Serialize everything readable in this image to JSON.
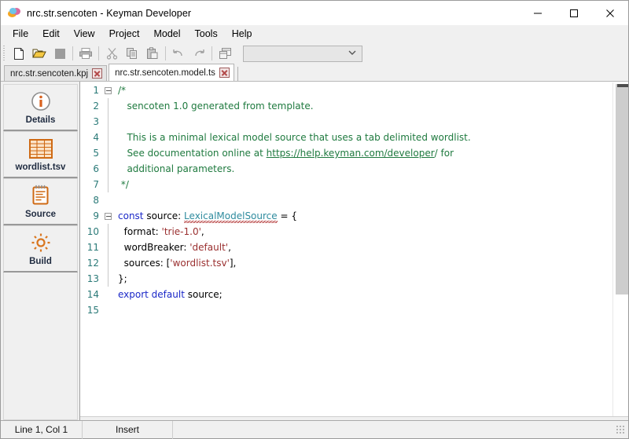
{
  "window": {
    "title": "nrc.str.sencoten - Keyman Developer",
    "icon": "keyman-logo-icon",
    "controls": [
      {
        "name": "minimize-button",
        "glyph": "minimize"
      },
      {
        "name": "maximize-button",
        "glyph": "maximize"
      },
      {
        "name": "close-button",
        "glyph": "close"
      }
    ]
  },
  "menubar": {
    "items": [
      {
        "label": "File"
      },
      {
        "label": "Edit"
      },
      {
        "label": "View"
      },
      {
        "label": "Project"
      },
      {
        "label": "Model"
      },
      {
        "label": "Tools"
      },
      {
        "label": "Help"
      }
    ]
  },
  "toolbar": {
    "buttons": [
      {
        "name": "new-file-button",
        "icon": "new-document-icon"
      },
      {
        "name": "open-file-button",
        "icon": "open-folder-icon"
      },
      {
        "name": "save-file-button",
        "icon": "save-disk-icon"
      },
      {
        "name": "print-button",
        "icon": "printer-icon"
      },
      {
        "name": "cut-button",
        "icon": "scissors-icon"
      },
      {
        "name": "copy-button",
        "icon": "copy-icon"
      },
      {
        "name": "paste-button",
        "icon": "paste-icon"
      },
      {
        "name": "undo-button",
        "icon": "undo-arrow-icon"
      },
      {
        "name": "redo-button",
        "icon": "redo-arrow-icon"
      },
      {
        "name": "windows-button",
        "icon": "cascade-windows-icon"
      }
    ],
    "combo": {
      "value": "",
      "placeholder": ""
    }
  },
  "tabs": [
    {
      "label": "nrc.str.sencoten.kpj",
      "active": false,
      "close": "close-tab-icon"
    },
    {
      "label": "nrc.str.sencoten.model.ts",
      "active": true,
      "close": "close-tab-icon"
    }
  ],
  "sidebar": {
    "items": [
      {
        "label": "Details",
        "icon": "info-circle-icon"
      },
      {
        "label": "wordlist.tsv",
        "icon": "table-grid-icon"
      },
      {
        "label": "Source",
        "icon": "notepad-icon"
      },
      {
        "label": "Build",
        "icon": "gear-icon"
      }
    ]
  },
  "editor": {
    "lines": [
      {
        "num": "1",
        "fold": "collapse",
        "segments": [
          {
            "t": "/*",
            "c": "c-com"
          }
        ]
      },
      {
        "num": "2",
        "fold": "bar",
        "segments": [
          {
            "t": "   sencoten 1.0 generated from template.",
            "c": "c-com"
          }
        ]
      },
      {
        "num": "3",
        "fold": "bar",
        "segments": []
      },
      {
        "num": "4",
        "fold": "bar",
        "segments": [
          {
            "t": "   This is a minimal lexical model source that uses a tab delimited wordlist.",
            "c": "c-com"
          }
        ]
      },
      {
        "num": "5",
        "fold": "bar",
        "segments": [
          {
            "t": "   See documentation online at ",
            "c": "c-com"
          },
          {
            "t": "https://help.keyman.com/developer",
            "c": "link"
          },
          {
            "t": "/ for",
            "c": "c-com"
          }
        ]
      },
      {
        "num": "6",
        "fold": "bar",
        "segments": [
          {
            "t": "   additional parameters.",
            "c": "c-com"
          }
        ]
      },
      {
        "num": "7",
        "fold": "bar",
        "segments": [
          {
            "t": " */",
            "c": "c-com"
          }
        ]
      },
      {
        "num": "8",
        "fold": "none",
        "segments": []
      },
      {
        "num": "9",
        "fold": "collapse",
        "segments": [
          {
            "t": "const",
            "c": "c-kw"
          },
          {
            "t": " source: ",
            "c": "c-id"
          },
          {
            "t": "LexicalModelSource",
            "c": "c-type squig"
          },
          {
            "t": " = {",
            "c": "c-id"
          }
        ]
      },
      {
        "num": "10",
        "fold": "bar",
        "segments": [
          {
            "t": "  format: ",
            "c": "c-id"
          },
          {
            "t": "'trie-1.0'",
            "c": "c-str"
          },
          {
            "t": ",",
            "c": "c-id"
          }
        ]
      },
      {
        "num": "11",
        "fold": "bar",
        "segments": [
          {
            "t": "  wordBreaker: ",
            "c": "c-id"
          },
          {
            "t": "'default'",
            "c": "c-str"
          },
          {
            "t": ",",
            "c": "c-id"
          }
        ]
      },
      {
        "num": "12",
        "fold": "bar",
        "segments": [
          {
            "t": "  sources: [",
            "c": "c-id"
          },
          {
            "t": "'wordlist.tsv'",
            "c": "c-str"
          },
          {
            "t": "],",
            "c": "c-id"
          }
        ]
      },
      {
        "num": "13",
        "fold": "bar",
        "segments": [
          {
            "t": "};",
            "c": "c-id"
          }
        ]
      },
      {
        "num": "14",
        "fold": "none",
        "segments": [
          {
            "t": "export default",
            "c": "c-kw"
          },
          {
            "t": " source;",
            "c": "c-id"
          }
        ]
      },
      {
        "num": "15",
        "fold": "none",
        "segments": []
      }
    ]
  },
  "statusbar": {
    "caret": "Line 1, Col 1",
    "mode": "Insert",
    "extra": ""
  },
  "colors": {
    "accent_orange": "#d96a23",
    "comment_green": "#1f7a3f",
    "keyword_blue": "#1b28c8",
    "string_red": "#9a2f2f",
    "linenum_teal": "#2b7a78",
    "modified_marker": "#c4575a",
    "chrome_gray": "#f0f0f0"
  }
}
